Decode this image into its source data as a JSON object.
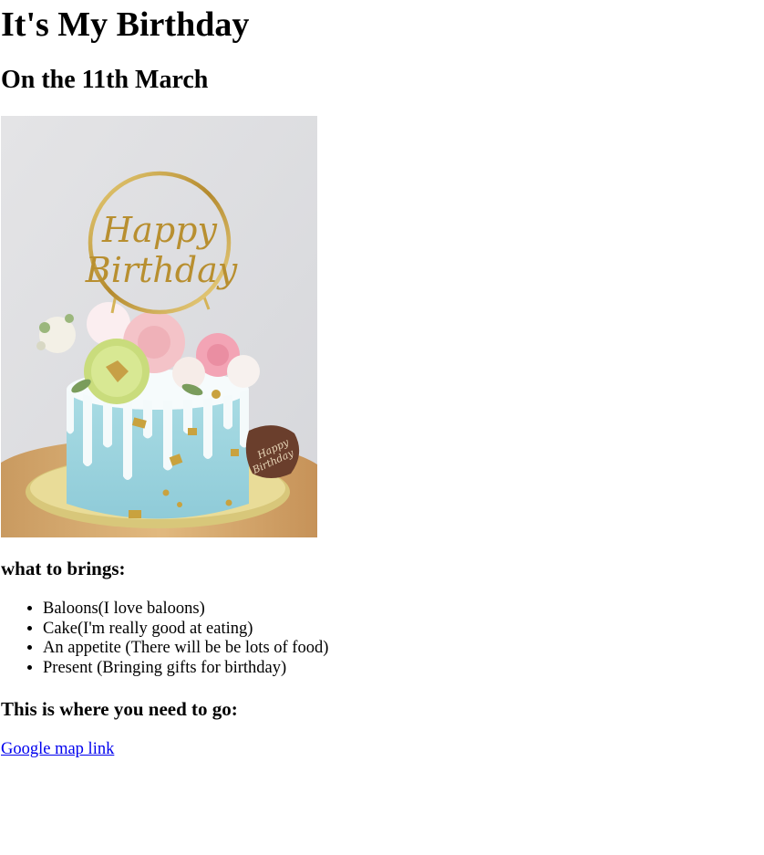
{
  "page": {
    "title": "It's My Birthday",
    "subtitle": "On the 11th March"
  },
  "image": {
    "alt": "Birthday cake with Happy Birthday topper",
    "topper_text_line1": "Happy",
    "topper_text_line2": "Birthday",
    "tag_text_line1": "Happy",
    "tag_text_line2": "Birthday"
  },
  "bring": {
    "heading": "what to brings:",
    "items": [
      "Baloons(I love baloons)",
      "Cake(I'm really good at eating)",
      "An appetite (There will be be lots of food)",
      "Present (Bringing gifts for birthday)"
    ]
  },
  "location": {
    "heading": "This is where you need to go:",
    "link_text": "Google map link"
  },
  "colors": {
    "link": "#0000ee",
    "text": "#000000",
    "background": "#ffffff"
  }
}
